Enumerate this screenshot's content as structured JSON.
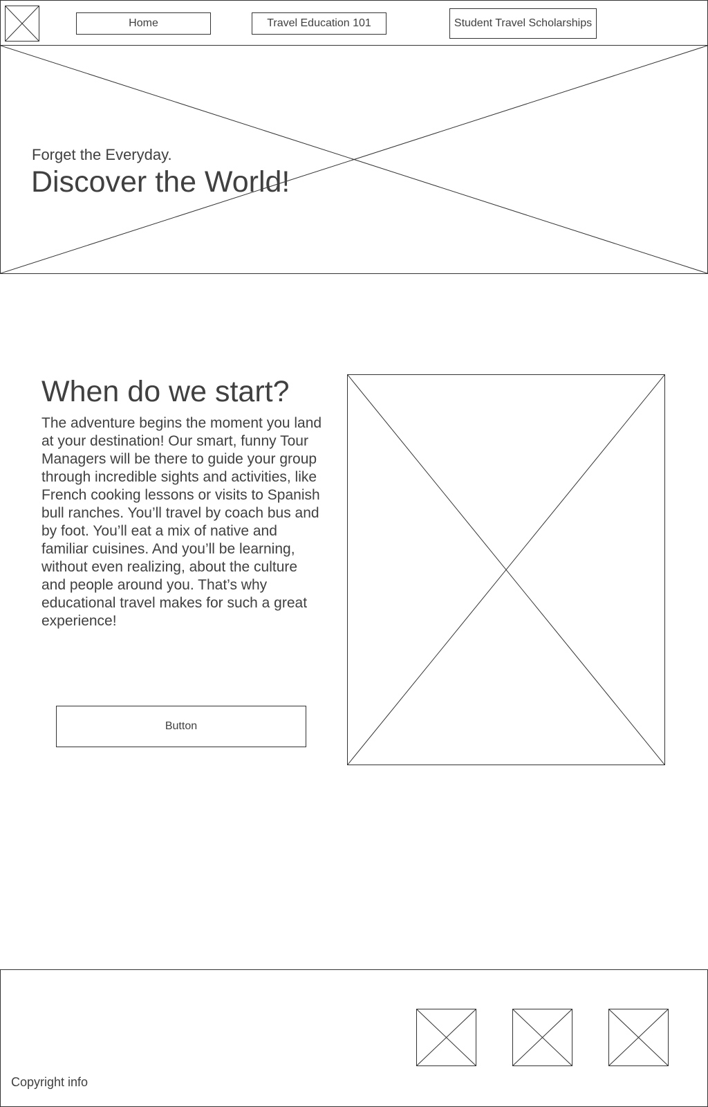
{
  "header": {
    "logo": {
      "icon": "image-placeholder-icon"
    },
    "nav": [
      {
        "label": "Home"
      },
      {
        "label": "Travel Education 101"
      },
      {
        "label": "Student Travel Scholarships"
      }
    ]
  },
  "hero": {
    "image": {
      "icon": "image-placeholder-icon"
    },
    "tagline": "Forget the Everyday.",
    "title": "Discover the World!"
  },
  "intro_section": {
    "title": "When do we start?",
    "body": "The adventure begins the moment you land at your destination! Our smart, funny Tour Managers will be there to guide your group through incredible sights and activities, like French cooking lessons or visits to Spanish bull ranches. You’ll travel by coach bus and by foot. You’ll eat a mix of native and familiar cuisines. And you’ll be learning, without even realizing, about the culture and people around you. That’s why educational travel makes for such a great experience!",
    "button_label": "Button",
    "image": {
      "icon": "image-placeholder-icon"
    }
  },
  "footer": {
    "copyright": "Copyright info",
    "social_icons": [
      {
        "icon": "image-placeholder-icon"
      },
      {
        "icon": "image-placeholder-icon"
      },
      {
        "icon": "image-placeholder-icon"
      }
    ]
  }
}
